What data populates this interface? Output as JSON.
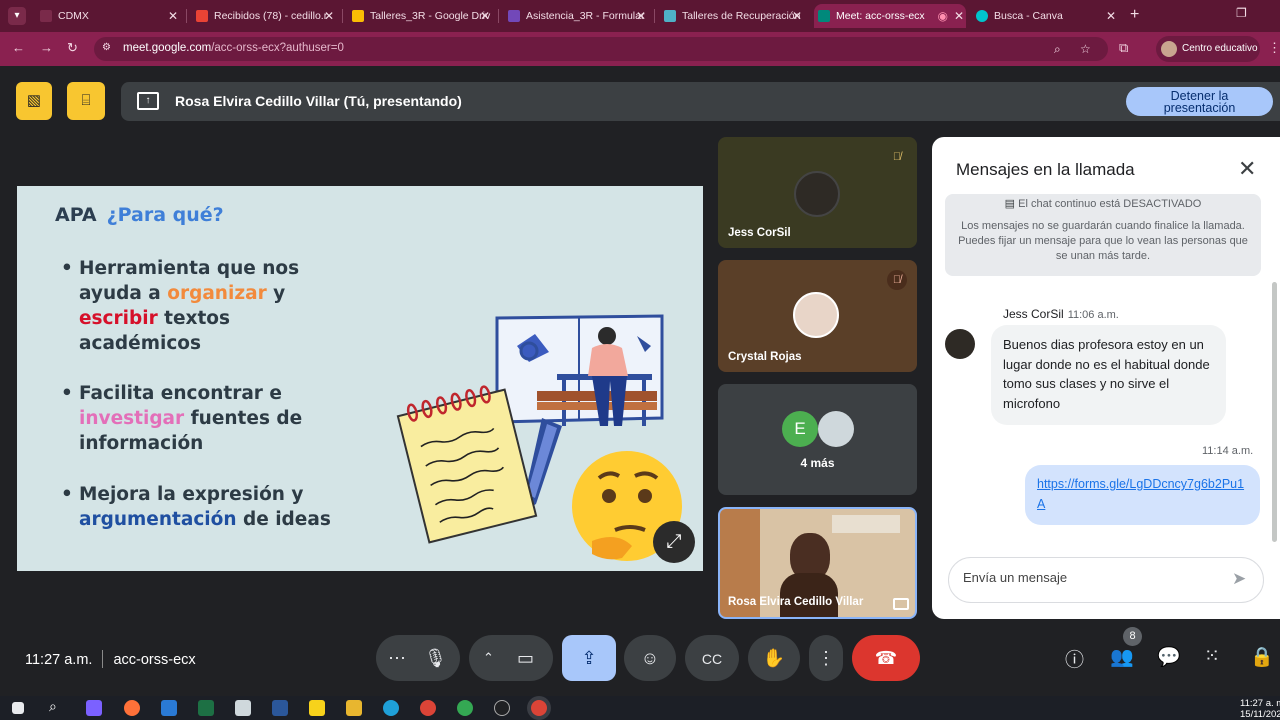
{
  "browser": {
    "tabs": [
      {
        "title": "CDMX",
        "favicon_color": "#7a2a4a"
      },
      {
        "title": "Recibidos (78) - cedillo.r",
        "favicon_color": "#ea4335"
      },
      {
        "title": "Talleres_3R - Google Driv",
        "favicon_color": "#fbbc04"
      },
      {
        "title": "Asistencia_3R - Formular",
        "favicon_color": "#7248b9"
      },
      {
        "title": "Talleres de Recuperación",
        "favicon_color": "#4fb0c6"
      },
      {
        "title": "Meet: acc-orss-ecx",
        "favicon_color": "#00897b"
      },
      {
        "title": "Busca - Canva",
        "favicon_color": "#00c4cc"
      }
    ],
    "url_host": "meet.google.com",
    "url_path": "/acc-orss-ecx?authuser=0",
    "profile_label": "Centro educativo"
  },
  "meet": {
    "presenting_text": "Rosa Elvira Cedillo Villar (Tú, presentando)",
    "stop_button_line1": "Detener la",
    "stop_button_line2": "presentación",
    "meeting_time": "11:27 a.m.",
    "meeting_code": "acc-orss-ecx",
    "people_count": "8"
  },
  "slide": {
    "title_apa": "APA",
    "title_q": "¿Para qué?",
    "b1_l1": "Herramienta que nos",
    "b1_l2a": "ayuda a ",
    "b1_l2b": "organizar",
    "b1_l2c": " y",
    "b1_l3a": "escribir",
    "b1_l3b": " textos",
    "b1_l4": "académicos",
    "b2_l1": "Facilita encontrar e",
    "b2_l2a": "investigar",
    "b2_l2b": " fuentes de",
    "b2_l3": "información",
    "b3_l1": "Mejora la expresión y",
    "b3_l2a": "argumentación",
    "b3_l2b": " de ideas"
  },
  "participants": {
    "p1_name": "Jess CorSil",
    "p2_name": "Crystal Rojas",
    "more_initial": "E",
    "more_label": "4 más",
    "self_name": "Rosa Elvira Cedillo Villar"
  },
  "chat": {
    "title": "Mensajes en la llamada",
    "continuous_status": "El chat continuo está DESACTIVADO",
    "info_text": "Los mensajes no se guardarán cuando finalice la llamada. Puedes fijar un mensaje para que lo vean las personas que se unan más tarde.",
    "msg1_sender": "Jess CorSil",
    "msg1_time": "11:06 a.m.",
    "msg1_text": "Buenos dias profesora estoy en un lugar donde no es el habitual donde tomo sus clases y no sirve el microfono",
    "msg2_time": "11:14 a.m.",
    "msg2_text": "https://forms.gle/LgDDcncy7g6b2Pu1A",
    "input_placeholder": "Envía un mensaje"
  },
  "taskbar": {
    "time": "11:27 a. m.",
    "date": "15/11/202"
  },
  "colors": {
    "browser_frame": "#5b1633",
    "browser_toolbar": "#8a2150",
    "accent_blue": "#a8c7fa",
    "end_call_red": "#dc362e",
    "slide_bg": "#d4e4e6",
    "yellow_button": "#f8c630"
  }
}
